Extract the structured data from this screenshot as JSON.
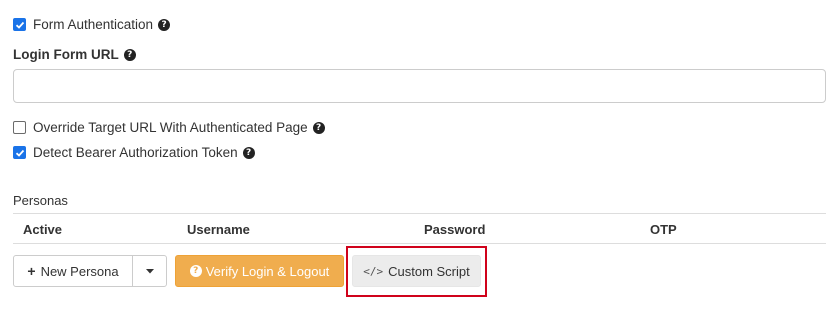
{
  "form_auth": {
    "checked": true,
    "label": "Form Authentication",
    "help_icon": "question-circle-icon"
  },
  "login_form_url": {
    "label": "Login Form URL",
    "help_icon": "question-circle-icon",
    "value": "",
    "placeholder": ""
  },
  "override_target": {
    "checked": false,
    "label": "Override Target URL With Authenticated Page",
    "help_icon": "question-circle-icon"
  },
  "detect_bearer": {
    "checked": true,
    "label": "Detect Bearer Authorization Token",
    "help_icon": "question-circle-icon"
  },
  "personas": {
    "title": "Personas",
    "columns": [
      "Active",
      "Username",
      "Password",
      "OTP"
    ],
    "rows": []
  },
  "actions": {
    "new_persona": {
      "label": "New Persona",
      "icon": "plus-icon"
    },
    "dropdown_icon": "caret-down-icon",
    "verify": {
      "label": "Verify Login & Logout",
      "icon": "question-circle-icon"
    },
    "custom_script": {
      "label": "Custom Script",
      "icon": "code-icon"
    }
  },
  "colors": {
    "checkbox_accent": "#1a73e8",
    "warning_button": "#f0ad4e",
    "highlight_border": "#d0021b"
  }
}
